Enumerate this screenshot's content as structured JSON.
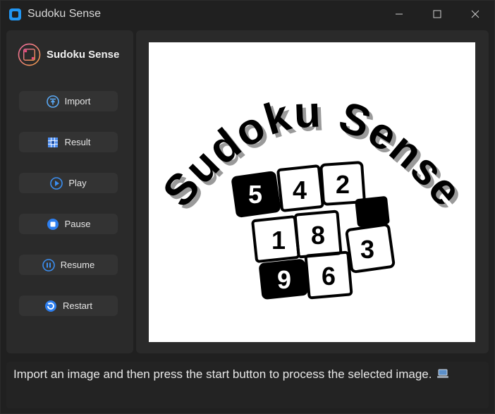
{
  "window": {
    "title": "Sudoku Sense"
  },
  "sidebar": {
    "brand_name": "Sudoku Sense",
    "buttons": [
      {
        "label": "Import",
        "icon": "import-icon"
      },
      {
        "label": "Result",
        "icon": "grid-icon"
      },
      {
        "label": "Play",
        "icon": "play-icon"
      },
      {
        "label": "Pause",
        "icon": "pause-icon"
      },
      {
        "label": "Resume",
        "icon": "resume-icon"
      },
      {
        "label": "Restart",
        "icon": "restart-icon"
      }
    ]
  },
  "preview": {
    "logo_text": "Sudoku Sense",
    "grid_digits": [
      "5",
      "4",
      "2",
      "1",
      "8",
      "9",
      "6",
      "3"
    ]
  },
  "status": {
    "message": "Import an image and then press the start button to process the selected image."
  },
  "colors": {
    "background": "#202020",
    "panel": "#2a2a2a",
    "button": "#333333",
    "accent": "#2196f3"
  }
}
